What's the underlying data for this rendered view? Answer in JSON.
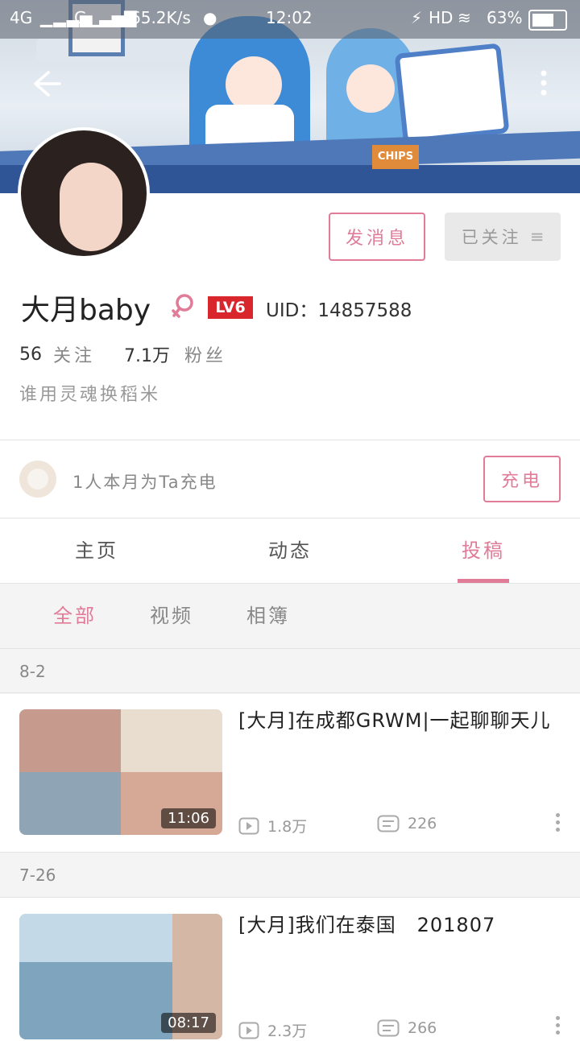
{
  "status_bar": {
    "network1": "4G",
    "network2": "G",
    "speed": "65.2K/s",
    "time": "12:02",
    "hd": "HD",
    "battery": "63%"
  },
  "profile": {
    "name": "大月baby",
    "level": "LV6",
    "uid": "UID：14857588",
    "following_count": "56",
    "following_label": "关注",
    "fans_count": "7.1万",
    "fans_label": "粉丝",
    "bio": "谁用灵魂换稻米"
  },
  "actions": {
    "message_label": "发消息",
    "followed_label": "已关注"
  },
  "charge": {
    "text": "1人本月为Ta充电",
    "button_label": "充电"
  },
  "tabs": [
    {
      "label": "主页",
      "active": false
    },
    {
      "label": "动态",
      "active": false
    },
    {
      "label": "投稿",
      "active": true
    }
  ],
  "subtabs": [
    {
      "label": "全部",
      "active": true
    },
    {
      "label": "视频",
      "active": false
    },
    {
      "label": "相簿",
      "active": false
    }
  ],
  "videos": [
    {
      "date": "8-2",
      "title": "[大月]在成都GRWM|一起聊聊天儿",
      "duration": "11:06",
      "plays": "1.8万",
      "comments": "226"
    },
    {
      "date": "7-26",
      "title": "[大月]我们在泰国   201807",
      "duration": "08:17",
      "plays": "2.3万",
      "comments": "266"
    }
  ],
  "colors": {
    "accent": "#e07b98",
    "level_badge": "#d9262c"
  }
}
